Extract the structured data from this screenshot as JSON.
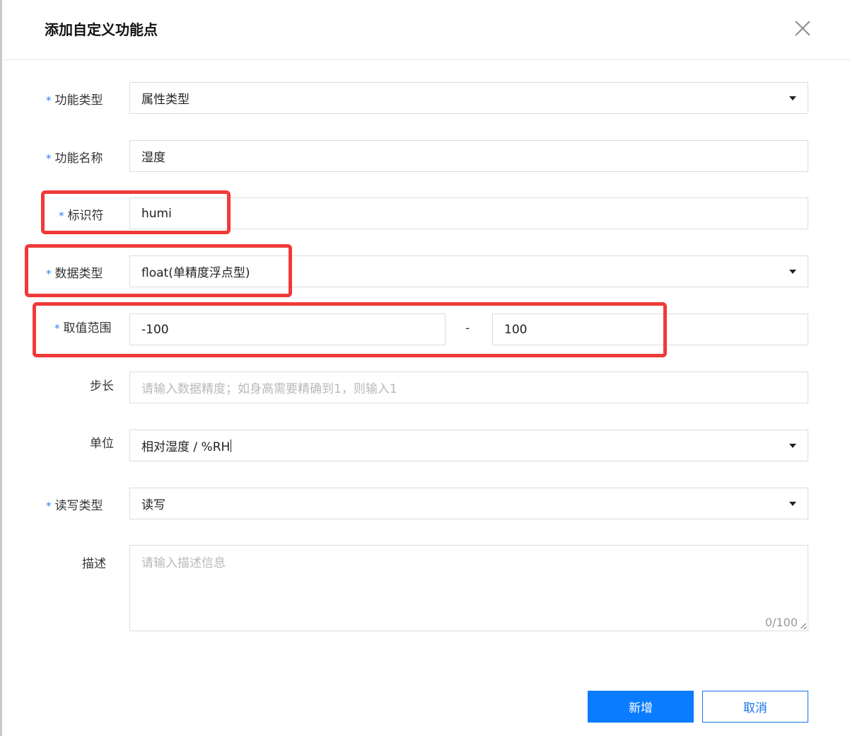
{
  "dialog": {
    "title": "添加自定义功能点",
    "close_icon": "close-icon"
  },
  "form": {
    "required_mark": "*",
    "function_type": {
      "label": "功能类型",
      "value": "属性类型"
    },
    "function_name": {
      "label": "功能名称",
      "value": "湿度"
    },
    "identifier": {
      "label": "标识符",
      "value": "humi"
    },
    "data_type": {
      "label": "数据类型",
      "value": "float(单精度浮点型)"
    },
    "value_range": {
      "label": "取值范围",
      "min": "-100",
      "separator": "-",
      "max": "100"
    },
    "step": {
      "label": "步长",
      "placeholder": "请输入数据精度；如身高需要精确到1，则输入1"
    },
    "unit": {
      "label": "单位",
      "value": "相对湿度 / %RH"
    },
    "rw_type": {
      "label": "读写类型",
      "value": "读写"
    },
    "description": {
      "label": "描述",
      "placeholder": "请输入描述信息",
      "counter": "0/100"
    }
  },
  "buttons": {
    "submit": "新增",
    "cancel": "取消"
  },
  "colors": {
    "primary": "#0a7cff",
    "required": "#2d7ff9",
    "highlight": "#f03a3a"
  }
}
